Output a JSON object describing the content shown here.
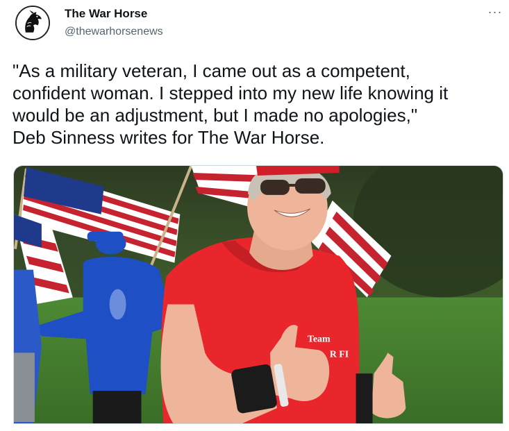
{
  "author": {
    "name": "The War Horse",
    "handle": "@thewarhorsenews",
    "avatar_icon": "war-horse-logo"
  },
  "more_icon": "more-options-icon",
  "more_glyph": "···",
  "tweet": {
    "lines": [
      "\"As a military veteran, I came out as a competent,",
      "confident woman. I stepped into my new life knowing it",
      "would be an adjustment, but I made no apologies,\"",
      "Deb Sinness writes for The War Horse."
    ]
  },
  "media": {
    "shirt_text_1": "Team",
    "shirt_text_2": "R FI"
  },
  "colors": {
    "text": "#0f1419",
    "secondary": "#536471",
    "shirt_red": "#e8262b",
    "grass": "#3f7a2c",
    "jacket_blue": "#1e4fc4"
  }
}
